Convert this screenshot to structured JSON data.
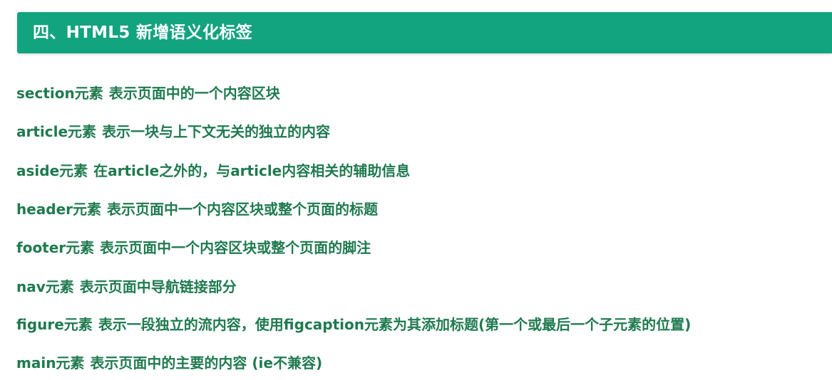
{
  "header": {
    "title": "四、HTML5 新增语义化标签"
  },
  "items": [
    {
      "tag": "section元素",
      "desc": "表示页面中的一个内容区块"
    },
    {
      "tag": "article元素",
      "desc": "表示一块与上下文无关的独立的内容"
    },
    {
      "tag": "aside元素",
      "desc": "在article之外的，与article内容相关的辅助信息"
    },
    {
      "tag": "header元素",
      "desc": "表示页面中一个内容区块或整个页面的标题"
    },
    {
      "tag": "footer元素",
      "desc": "表示页面中一个内容区块或整个页面的脚注"
    },
    {
      "tag": "nav元素",
      "desc": "表示页面中导航链接部分"
    },
    {
      "tag": "figure元素",
      "desc": "表示一段独立的流内容，使用figcaption元素为其添加标题(第一个或最后一个子元素的位置)"
    },
    {
      "tag": "main元素",
      "desc": "表示页面中的主要的内容 (ie不兼容)"
    }
  ],
  "colors": {
    "header_background": "#12a37f",
    "header_text": "#ffffff",
    "item_text": "#1f7a4f"
  }
}
